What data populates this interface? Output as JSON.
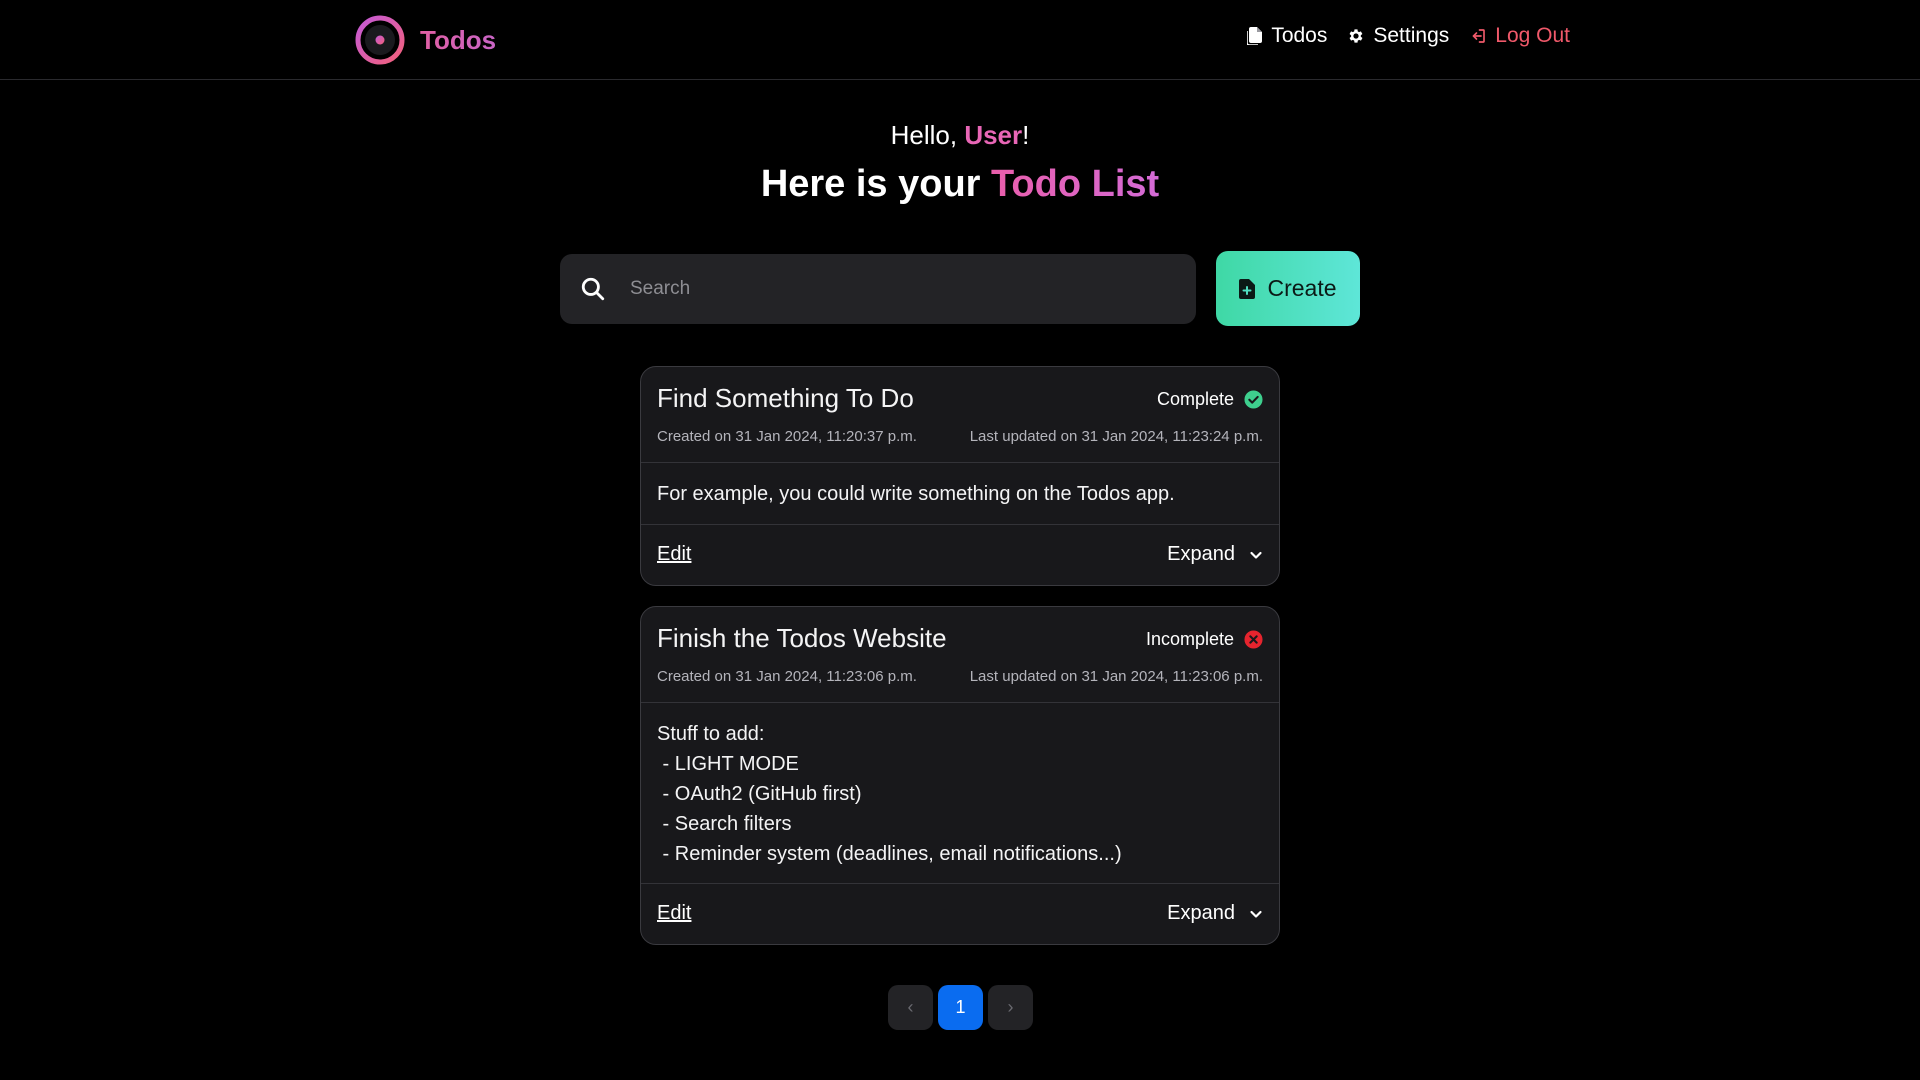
{
  "nav": {
    "brand": "Todos",
    "links": {
      "todos": "Todos",
      "settings": "Settings",
      "logout": "Log Out"
    }
  },
  "header": {
    "greeting_prefix": "Hello, ",
    "user_name": "User",
    "greeting_suffix": "!",
    "title_prefix": "Here is your ",
    "title_accent": "Todo List"
  },
  "search": {
    "placeholder": "Search",
    "value": ""
  },
  "create_button": {
    "label": "Create"
  },
  "todos": [
    {
      "title": "Find Something To Do",
      "status": "Complete",
      "created": "Created on 31 Jan 2024, 11:20:37 p.m.",
      "updated": "Last updated on 31 Jan 2024, 11:23:24 p.m.",
      "body": [
        "For example, you could write something on the Todos app."
      ],
      "edit_label": "Edit",
      "expand_label": "Expand"
    },
    {
      "title": "Finish the Todos Website",
      "status": "Incomplete",
      "created": "Created on 31 Jan 2024, 11:23:06 p.m.",
      "updated": "Last updated on 31 Jan 2024, 11:23:06 p.m.",
      "body": [
        "Stuff to add:",
        " - LIGHT MODE",
        " - OAuth2 (GitHub first)",
        " - Search filters",
        " - Reminder system (deadlines, email notifications...)"
      ],
      "edit_label": "Edit",
      "expand_label": "Expand"
    }
  ],
  "pagination": {
    "prev": "‹",
    "current": "1",
    "next": "›"
  },
  "colors": {
    "background": "#000000",
    "accent_pink": "#e866b6",
    "create_gradient_start": "#3fd8a5",
    "create_gradient_end": "#5ee6d8",
    "complete_green": "#3ecf8e",
    "incomplete_red": "#e5242e",
    "logout_red": "#f0596a",
    "page_active_blue": "#0a6cf0"
  },
  "icons": {
    "brand": "target-ring-logo",
    "todos": "document-stack-icon",
    "settings": "gear-icon",
    "logout": "logout-icon",
    "search": "search-icon",
    "create": "file-plus-icon",
    "complete": "check-circle-icon",
    "incomplete": "x-circle-icon",
    "expand": "chevron-down-icon"
  }
}
